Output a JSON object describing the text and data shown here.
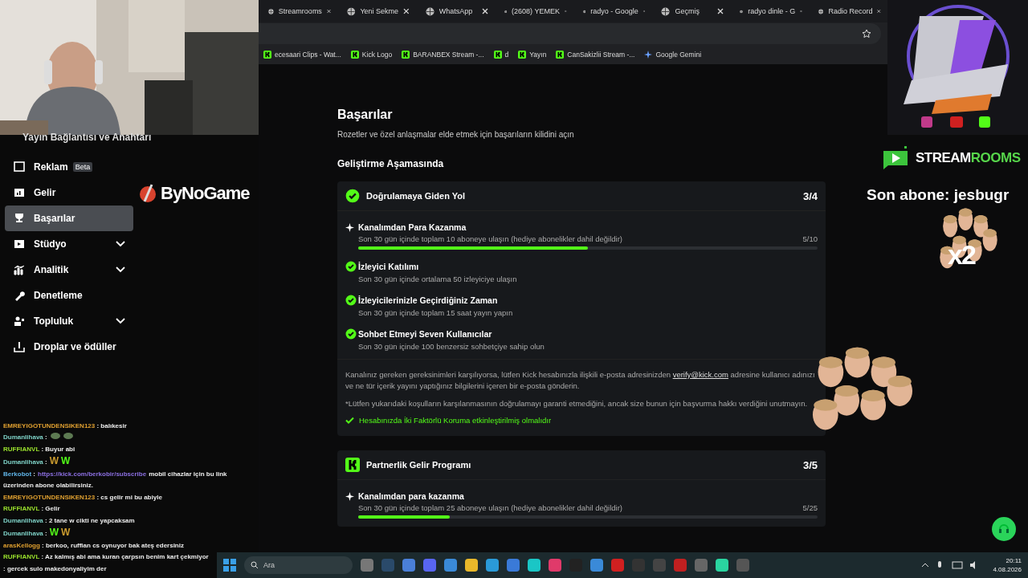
{
  "browser": {
    "tabs": [
      {
        "label": "Streamrooms",
        "selected": false
      },
      {
        "label": "Yeni Sekme",
        "selected": false
      },
      {
        "label": "WhatsApp",
        "selected": false
      },
      {
        "label": "(2608) YEMEK",
        "selected": false
      },
      {
        "label": "radyo - Google",
        "selected": false
      },
      {
        "label": "Geçmiş",
        "selected": false
      },
      {
        "label": "radyo dinle - G",
        "selected": false
      },
      {
        "label": "Radio Record",
        "selected": false
      }
    ],
    "bookmarks": [
      "ecesaari Clips - Wat...",
      "Kick Logo",
      "BARANBEX Stream -...",
      "d",
      "Yayın",
      "CanSakizlii Stream -...",
      "Google Gemini"
    ]
  },
  "sidebar": {
    "cut_item": "Yayın Bağlantısı ve Anahtarı",
    "items": [
      {
        "label": "Reklam",
        "badge": "Beta",
        "expandable": false,
        "selected": false
      },
      {
        "label": "Gelir",
        "expandable": false,
        "selected": false
      },
      {
        "label": "Başarılar",
        "expandable": false,
        "selected": true
      },
      {
        "label": "Stüdyo",
        "expandable": true,
        "selected": false
      },
      {
        "label": "Analitik",
        "expandable": true,
        "selected": false
      },
      {
        "label": "Denetleme",
        "expandable": false,
        "selected": false
      },
      {
        "label": "Topluluk",
        "expandable": true,
        "selected": false
      },
      {
        "label": "Droplar ve ödüller",
        "expandable": false,
        "selected": false
      }
    ]
  },
  "sponsor": "ByNoGame",
  "chat": [
    {
      "user": "EMREYIGOTUNDENSIKEN123",
      "color": "#e0a030",
      "parts": [
        {
          "kind": "text",
          "text": ": balıkesir"
        }
      ]
    },
    {
      "user": "Dumanlihava",
      "color": "#7fd3c8",
      "parts": [
        {
          "kind": "text",
          "text": ":"
        },
        {
          "kind": "sticker"
        },
        {
          "kind": "sticker"
        }
      ]
    },
    {
      "user": "RUFFIANVL",
      "color": "#9be22d",
      "parts": [
        {
          "kind": "text",
          "text": ": Buyur abi"
        }
      ]
    },
    {
      "user": "Dumanlihava",
      "color": "#7fd3c8",
      "parts": [
        {
          "kind": "text",
          "text": ":"
        },
        {
          "kind": "emote",
          "text": "W",
          "color": "#c99a2e"
        },
        {
          "kind": "emote",
          "text": "W",
          "color": "#53fc18"
        }
      ]
    },
    {
      "user": "Berkobot",
      "color": "#5fb3e6",
      "parts": [
        {
          "kind": "text",
          "text": ":"
        },
        {
          "kind": "link",
          "text": "https://kick.com/berkobir/subscribe"
        },
        {
          "kind": "text",
          "text": "mobil cihazlar için bu link üzerinden abone olabilirsiniz."
        }
      ]
    },
    {
      "user": "EMREYIGOTUNDENSIKEN123",
      "color": "#e0a030",
      "parts": [
        {
          "kind": "text",
          "text": ": cs gelir mi bu abiyle"
        }
      ]
    },
    {
      "user": "RUFFIANVL",
      "color": "#9be22d",
      "parts": [
        {
          "kind": "text",
          "text": ": Gelir"
        }
      ]
    },
    {
      "user": "Dumanlihava",
      "color": "#7fd3c8",
      "parts": [
        {
          "kind": "text",
          "text": ": 2 tane w cikti ne yapcaksam"
        }
      ]
    },
    {
      "user": "Dumanlihava",
      "color": "#7fd3c8",
      "parts": [
        {
          "kind": "text",
          "text": ":"
        },
        {
          "kind": "emote",
          "text": "W",
          "color": "#53fc18"
        },
        {
          "kind": "emote",
          "text": "W",
          "color": "#c99a2e"
        }
      ]
    },
    {
      "user": "arasKellogg",
      "color": "#e0a030",
      "parts": [
        {
          "kind": "text",
          "text": ": berkoo, ruffian cs oynuyor bak ateş edersiniz"
        }
      ]
    },
    {
      "user": "RUFFIANVL",
      "color": "#9be22d",
      "parts": [
        {
          "kind": "text",
          "text": ": Az kalmış abi ama kuran çarpsın benim kart çekmiyor"
        }
      ]
    },
    {
      "parts": [
        {
          "kind": "text",
          "text": ": gercek sulo makedonyaliyim der"
        }
      ]
    }
  ],
  "page": {
    "title": "Başarılar",
    "subtitle": "Rozetler ve özel anlaşmalar elde etmek için başarıların kilidini açın",
    "section": "Geliştirme Aşamasında",
    "cards": [
      {
        "title": "Doğrulamaya Giden Yol",
        "count": "3/4",
        "items": [
          {
            "kind": "progress",
            "title": "Kanalımdan Para Kazanma",
            "desc": "Son 30 gün içinde toplam 10 aboneye ulaşın (hediye abonelikler dahil değildir)",
            "reading": "5/10",
            "level": 0.5
          },
          {
            "kind": "done",
            "title": "İzleyici Katılımı",
            "desc": "Son 30 gün içinde ortalama 50 izleyiciye ulaşın"
          },
          {
            "kind": "done",
            "title": "İzleyicilerinizle Geçirdiğiniz Zaman",
            "desc": "Son 30 gün içinde toplam 15 saat yayın yapın"
          },
          {
            "kind": "done",
            "title": "Sohbet Etmeyi Seven Kullanıcılar",
            "desc": "Son 30 gün içinde 100 benzersiz sohbetçiye sahip olun"
          }
        ],
        "note": {
          "before": "Kanalınız gereken gereksinimleri karşılıyorsa, lütfen Kick hesabınızla ilişkili e-posta adresinizden",
          "link": "verify@kick.com",
          "after": "adresine kullanıcı adınızı ve ne tür içerik yayını yaptığınız bilgilerini içeren bir e-posta gönderin."
        },
        "disclaimer": "*Lütfen yukarıdaki koşulların karşılanmasının doğrulamayı garanti etmediğini, ancak size bunun için başvurma hakkı verdiğini unutmayın.",
        "requirement": "Hesabınızda İki Faktörlü Koruma etkinleştirilmiş olmalıdır"
      },
      {
        "title": "Partnerlik Gelir Programı",
        "count": "3/5",
        "items": [
          {
            "kind": "progress",
            "title": "Kanalımdan para kazanma",
            "desc": "Son 30 gün içinde toplam 25 aboneye ulaşın (hediye abonelikler dahil değildir)",
            "reading": "5/25",
            "level": 0.2
          }
        ]
      }
    ]
  },
  "overlay": {
    "brand_a": "STREAM",
    "brand_b": "ROOMS",
    "last_sub": "Son abone: jesbugr",
    "multiplier": "x2"
  },
  "taskbar": {
    "search": "Ara",
    "time": "20:11",
    "date": "4.08.2026"
  }
}
